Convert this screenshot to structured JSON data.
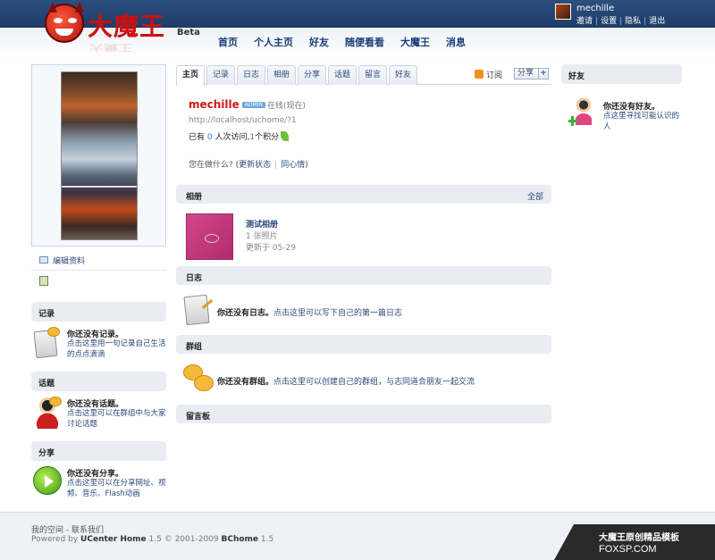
{
  "header": {
    "logo_text": "大魔王",
    "beta": "Beta",
    "nav": [
      "首页",
      "个人主页",
      "好友",
      "随便看看",
      "大魔王",
      "消息"
    ],
    "username": "mechille",
    "user_links": [
      "邀请",
      "设置",
      "隐私",
      "退出"
    ]
  },
  "left": {
    "edit_profile": "编辑资料",
    "sections": [
      {
        "title": "记录",
        "empty_title": "你还没有记录。",
        "empty_text": "点击这里用一句记录自己生活的点点滴滴",
        "icon": "note-bubble-icon"
      },
      {
        "title": "话题",
        "empty_title": "你还没有话题。",
        "empty_text": "点击这里可以在群组中与大家讨论话题",
        "icon": "topic-person-icon"
      },
      {
        "title": "分享",
        "empty_title": "你还没有分享。",
        "empty_text": "点击这里可以在分享网址、视频、音乐、Flash动画",
        "icon": "share-play-icon"
      }
    ]
  },
  "tabs": [
    "主页",
    "记录",
    "日志",
    "相册",
    "分享",
    "话题",
    "留言",
    "好友"
  ],
  "feed_label": "订阅",
  "share_label": "分享",
  "profile": {
    "name": "mechille",
    "role_badge": "ADMIN",
    "online": "在线(现在)",
    "url": "http://localhost/uchome/?1",
    "stats_prefix": "已有",
    "visits": "0",
    "stats_mid": "人次访问,",
    "points": "1",
    "stats_suffix": "个积分",
    "doing_prompt": "您在做什么?",
    "update_status": "(更新状态",
    "same_mood": "同心情)"
  },
  "albums": {
    "title": "相册",
    "all": "全部",
    "items": [
      {
        "name": "测试相册",
        "count": "1 张照片",
        "updated": "更新于 05-29"
      }
    ]
  },
  "blog": {
    "title": "日志",
    "empty_title": "你还没有日志。",
    "empty_text": "点击这里可以写下自己的第一篇日志"
  },
  "group": {
    "title": "群组",
    "empty_title": "你还没有群组。",
    "empty_text": "点击这里可以创建自己的群组，与志同道合朋友一起交流"
  },
  "guestbook": {
    "title": "留言板"
  },
  "right": {
    "friends_title": "好友",
    "empty_title": "你还没有好友。",
    "empty_text": "点这里寻找可能认识的人"
  },
  "footer": {
    "links": "我的空间 - 联系我们",
    "powered_prefix": "Powered by",
    "product": "UCenter Home",
    "version": "1.5 © 2001-2009",
    "bchome": "BChome",
    "bchome_version": "1.5"
  },
  "badge": {
    "line1": "大魔王原创精品模板",
    "line2": "FOXSP.COM"
  },
  "colors": {
    "nav_blue": "#1b3d78",
    "link": "#2b4a78",
    "name_red": "#d11818",
    "topbar": "#2c4f7f"
  }
}
